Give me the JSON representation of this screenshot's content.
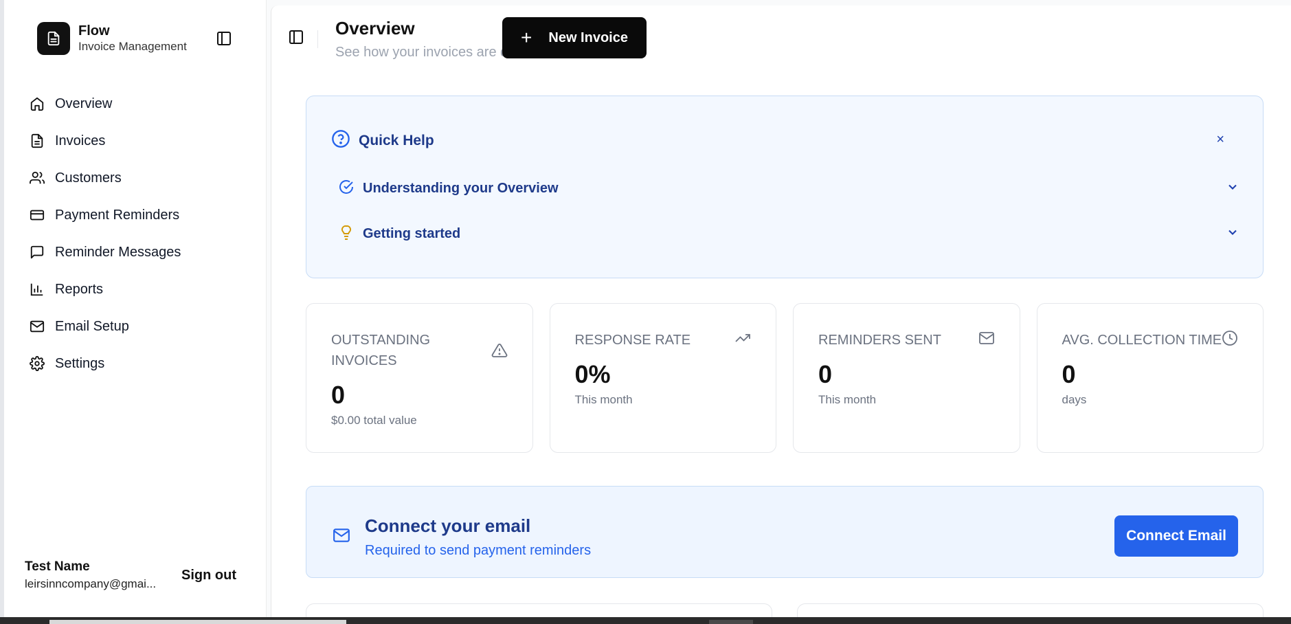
{
  "brand": {
    "name": "Flow",
    "subtitle": "Invoice Management"
  },
  "sidebar": {
    "items": [
      {
        "label": "Overview",
        "icon": "home-icon"
      },
      {
        "label": "Invoices",
        "icon": "file-text-icon"
      },
      {
        "label": "Customers",
        "icon": "users-icon"
      },
      {
        "label": "Payment Reminders",
        "icon": "credit-card-icon"
      },
      {
        "label": "Reminder Messages",
        "icon": "message-square-icon"
      },
      {
        "label": "Reports",
        "icon": "bar-chart-icon"
      },
      {
        "label": "Email Setup",
        "icon": "mail-icon"
      },
      {
        "label": "Settings",
        "icon": "gear-icon"
      }
    ]
  },
  "user": {
    "name": "Test Name",
    "email": "leirsinncompany@gmai...",
    "signout_label": "Sign out"
  },
  "header": {
    "title": "Overview",
    "subtitle": "See how your invoices are doing",
    "new_invoice_label": "New Invoice"
  },
  "help": {
    "title": "Quick Help",
    "close_label": "×",
    "rows": [
      {
        "label": "Understanding your Overview",
        "icon": "check-circle-icon"
      },
      {
        "label": "Getting started",
        "icon": "lightbulb-icon"
      }
    ]
  },
  "stats": [
    {
      "label": "OUTSTANDING INVOICES",
      "value": "0",
      "caption": "$0.00 total value",
      "icon": "alert-triangle-icon"
    },
    {
      "label": "RESPONSE RATE",
      "value": "0%",
      "caption": "This month",
      "icon": "trending-up-icon"
    },
    {
      "label": "REMINDERS SENT",
      "value": "0",
      "caption": "This month",
      "icon": "mail-icon"
    },
    {
      "label": "AVG. COLLECTION TIME",
      "value": "0",
      "caption": "days",
      "icon": "clock-icon"
    }
  ],
  "connect": {
    "title": "Connect your email",
    "subtitle": "Required to send payment reminders",
    "button_label": "Connect Email"
  },
  "colors": {
    "accent": "#2563eb",
    "help_bg": "#f3f8ff",
    "primary_button": "#0a0a0a",
    "help_text": "#1e3a8a",
    "bulb": "#d49a06"
  }
}
